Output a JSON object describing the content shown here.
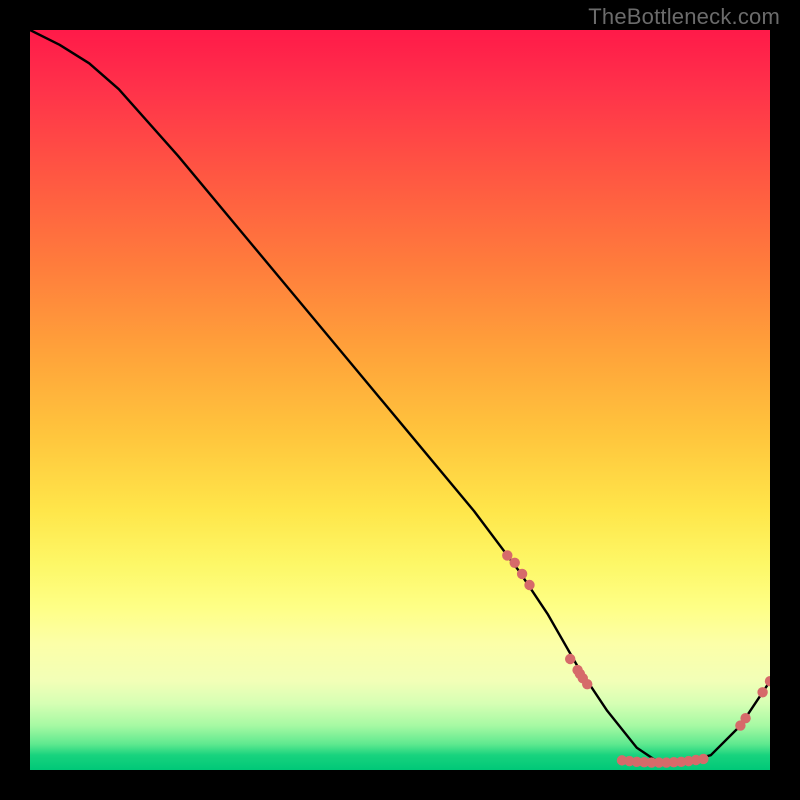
{
  "watermark": "TheBottleneck.com",
  "chart_data": {
    "type": "line",
    "title": "",
    "xlabel": "",
    "ylabel": "",
    "x_range": [
      0,
      100
    ],
    "y_range": [
      0,
      100
    ],
    "curve": {
      "name": "bottleneck-curve",
      "x": [
        0,
        4,
        8,
        12,
        20,
        30,
        40,
        50,
        60,
        66,
        70,
        74,
        78,
        82,
        85,
        88,
        92,
        96,
        100
      ],
      "y": [
        100,
        98,
        95.5,
        92,
        83,
        71,
        59,
        47,
        35,
        27,
        21,
        14,
        8,
        3,
        1,
        1,
        2,
        6,
        12
      ]
    },
    "markers": {
      "name": "highlight-points",
      "color": "#d66a6a",
      "points": [
        {
          "x": 64.5,
          "y": 29
        },
        {
          "x": 65.5,
          "y": 28
        },
        {
          "x": 66.5,
          "y": 26.5
        },
        {
          "x": 67.5,
          "y": 25
        },
        {
          "x": 73,
          "y": 15
        },
        {
          "x": 74,
          "y": 13.5
        },
        {
          "x": 74.3,
          "y": 13
        },
        {
          "x": 74.7,
          "y": 12.4
        },
        {
          "x": 75.3,
          "y": 11.6
        },
        {
          "x": 80,
          "y": 1.3
        },
        {
          "x": 81,
          "y": 1.2
        },
        {
          "x": 82,
          "y": 1.1
        },
        {
          "x": 83,
          "y": 1.05
        },
        {
          "x": 84,
          "y": 1.0
        },
        {
          "x": 85,
          "y": 1.0
        },
        {
          "x": 86,
          "y": 1.0
        },
        {
          "x": 87,
          "y": 1.05
        },
        {
          "x": 88,
          "y": 1.1
        },
        {
          "x": 89,
          "y": 1.2
        },
        {
          "x": 90,
          "y": 1.35
        },
        {
          "x": 91,
          "y": 1.5
        },
        {
          "x": 96,
          "y": 6
        },
        {
          "x": 96.7,
          "y": 7
        },
        {
          "x": 99,
          "y": 10.5
        },
        {
          "x": 100,
          "y": 12
        }
      ]
    },
    "gradient_stops": [
      {
        "pos": 0.0,
        "color": "#ff1a49"
      },
      {
        "pos": 0.5,
        "color": "#ffd33e"
      },
      {
        "pos": 0.8,
        "color": "#fcff9a"
      },
      {
        "pos": 1.0,
        "color": "#00c878"
      }
    ]
  }
}
